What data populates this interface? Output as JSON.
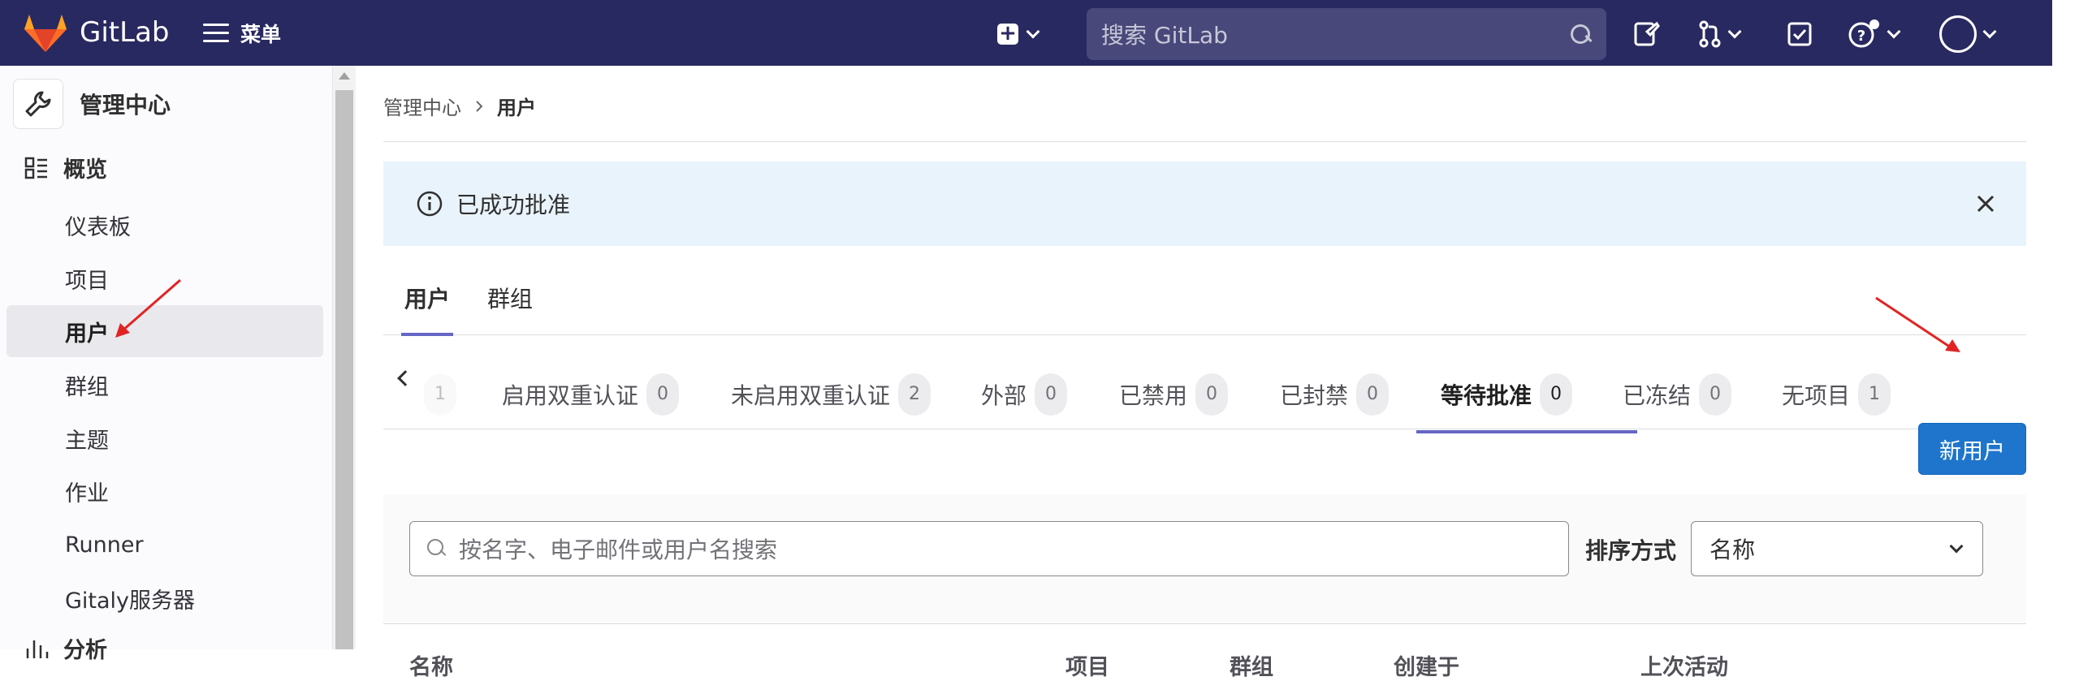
{
  "colors": {
    "topbar": "#292961",
    "accent": "#6666c4",
    "primary_button": "#1f75cb",
    "alert_bg": "#e9f3fc",
    "annotation": "#e02424"
  },
  "topbar": {
    "brand": "GitLab",
    "menu_label": "菜单",
    "search_placeholder": "搜索 GitLab",
    "icons": [
      "gitlab-logo",
      "hamburger-icon",
      "plus-square-icon",
      "chevron-down-icon",
      "search-icon",
      "issues-icon",
      "merge-request-icon",
      "todo-icon",
      "help-icon",
      "avatar"
    ]
  },
  "sidebar": {
    "title": "管理中心",
    "section": "概览",
    "items": [
      {
        "label": "仪表板"
      },
      {
        "label": "项目"
      },
      {
        "label": "用户"
      },
      {
        "label": "群组"
      },
      {
        "label": "主题"
      },
      {
        "label": "作业"
      },
      {
        "label": "Runner"
      },
      {
        "label": "Gitaly服务器"
      }
    ],
    "next_section": "分析"
  },
  "breadcrumb": {
    "parent": "管理中心",
    "current": "用户"
  },
  "alert": {
    "message": "已成功批准"
  },
  "main_tabs": [
    {
      "label": "用户"
    },
    {
      "label": "群组"
    }
  ],
  "sub_tabs": [
    {
      "label": "",
      "count": "1"
    },
    {
      "label": "启用双重认证",
      "count": "0"
    },
    {
      "label": "未启用双重认证",
      "count": "2"
    },
    {
      "label": "外部",
      "count": "0"
    },
    {
      "label": "已禁用",
      "count": "0"
    },
    {
      "label": "已封禁",
      "count": "0"
    },
    {
      "label": "等待批准",
      "count": "0"
    },
    {
      "label": "已冻结",
      "count": "0"
    },
    {
      "label": "无项目",
      "count": "1"
    }
  ],
  "new_user_button": "新用户",
  "filter": {
    "search_placeholder": "按名字、电子邮件或用户名搜索",
    "sort_label": "排序方式",
    "sort_value": "名称"
  },
  "table": {
    "columns": [
      "名称",
      "项目",
      "群组",
      "创建于",
      "上次活动"
    ]
  }
}
